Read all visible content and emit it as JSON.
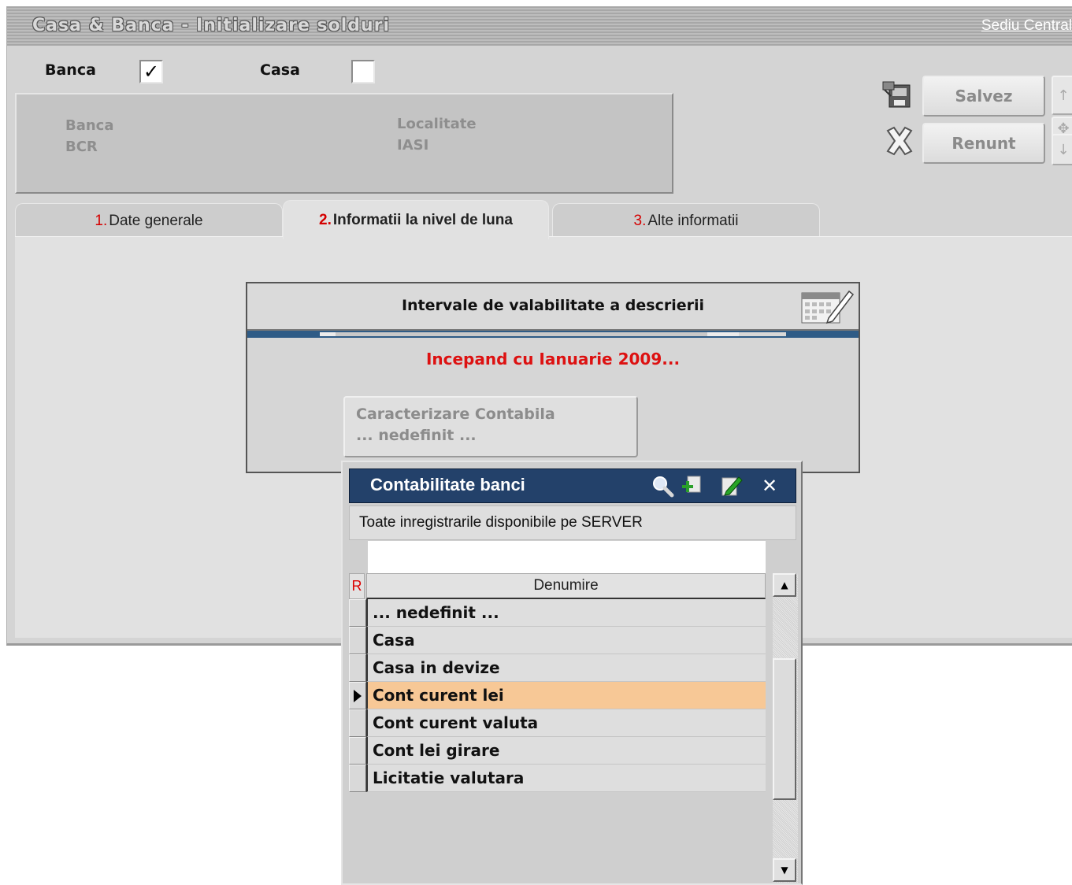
{
  "window": {
    "title": "Casa & Banca - Initializare solduri",
    "link": "Sediu Central"
  },
  "type_selector": {
    "banca_label": "Banca",
    "banca_checked": true,
    "casa_label": "Casa",
    "casa_checked": false
  },
  "info": {
    "banca_label": "Banca",
    "banca_value": "BCR",
    "localitate_label": "Localitate",
    "localitate_value": "IASI"
  },
  "actions": {
    "save_label": "Salvez",
    "cancel_label": "Renunt",
    "save_icon": "save-printer-icon",
    "cancel_icon": "cancel-x-icon"
  },
  "tabs": [
    {
      "num": "1.",
      "label": "Date generale",
      "active": false
    },
    {
      "num": "2.",
      "label": "Informatii la nivel de luna",
      "active": true
    },
    {
      "num": "3.",
      "label": "Alte informatii",
      "active": false
    }
  ],
  "interval": {
    "title": "Intervale de valabilitate a descrierii",
    "subtitle": "Incepand cu Ianuarie 2009...",
    "button_line1": "Caracterizare Contabila",
    "button_line2": "... nedefinit ..."
  },
  "popup": {
    "title": "Contabilitate banci",
    "filter_text": "Toate inregistrarile disponibile pe SERVER",
    "search_value": "",
    "column_r": "R",
    "column_name": "Denumire",
    "rows": [
      {
        "name": "... nedefinit ...",
        "selected": false
      },
      {
        "name": "Casa",
        "selected": false
      },
      {
        "name": "Casa in devize",
        "selected": false
      },
      {
        "name": "Cont curent lei",
        "selected": true
      },
      {
        "name": "Cont curent valuta",
        "selected": false
      },
      {
        "name": "Cont lei girare",
        "selected": false
      },
      {
        "name": "Licitatie valutara",
        "selected": false
      }
    ]
  },
  "colors": {
    "popup_header": "#23416a",
    "selected_row": "#f7c896",
    "subtitle_red": "#dd1111"
  }
}
